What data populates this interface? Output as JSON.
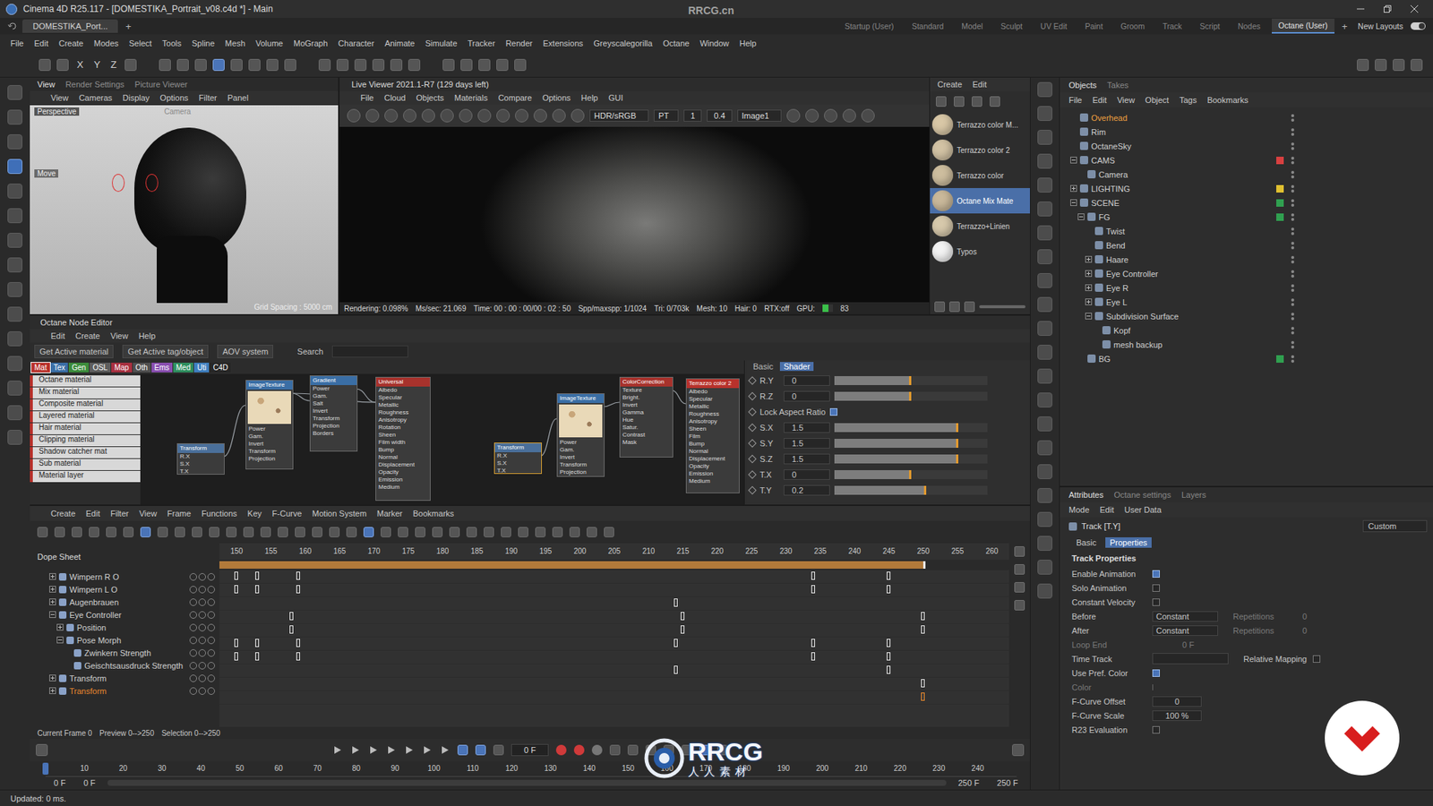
{
  "window": {
    "title": "Cinema 4D R25.117 - [DOMESTIKA_Portrait_v08.c4d *] - Main"
  },
  "watermark": {
    "site": "RRCG.cn",
    "logo": "RRCG",
    "subtitle": "人人素材"
  },
  "doc_tabs": [
    {
      "label": "DOMESTIKA_Port...",
      "selected": true
    }
  ],
  "doc_add": "+",
  "layouts": [
    {
      "label": "Startup (User)",
      "selected": false
    },
    {
      "label": "Standard",
      "selected": false
    },
    {
      "label": "Model",
      "selected": false
    },
    {
      "label": "Sculpt",
      "selected": false
    },
    {
      "label": "UV Edit",
      "selected": false
    },
    {
      "label": "Paint",
      "selected": false
    },
    {
      "label": "Groom",
      "selected": false
    },
    {
      "label": "Track",
      "selected": false
    },
    {
      "label": "Script",
      "selected": false
    },
    {
      "label": "Nodes",
      "selected": false
    },
    {
      "label": "Octane (User)",
      "selected": true
    }
  ],
  "layout_add": "+",
  "new_layouts": "New Layouts",
  "menu": [
    "File",
    "Edit",
    "Create",
    "Modes",
    "Select",
    "Tools",
    "Spline",
    "Mesh",
    "Volume",
    "MoGraph",
    "Character",
    "Animate",
    "Simulate",
    "Tracker",
    "Render",
    "Extensions",
    "Greyscalegorilla",
    "Octane",
    "Window",
    "Help"
  ],
  "toolbar": {
    "axes": [
      "X",
      "Y",
      "Z"
    ]
  },
  "viewport": {
    "tabs": [
      {
        "label": "View",
        "selected": true
      },
      {
        "label": "Render Settings",
        "selected": false
      },
      {
        "label": "Picture Viewer",
        "selected": false
      }
    ],
    "menu": [
      "View",
      "Cameras",
      "Display",
      "Options",
      "Filter",
      "Panel"
    ],
    "camera_label": "Perspective",
    "camera_name": "Camera",
    "tool": "Move",
    "grid": "Grid Spacing : 5000 cm"
  },
  "live_viewer": {
    "title": "Live Viewer 2021.1-R7 (129 days left)",
    "menu": [
      "File",
      "Cloud",
      "Objects",
      "Materials",
      "Compare",
      "Options",
      "Help",
      "GUI"
    ],
    "color_space": "HDR/sRGB",
    "kernel": "PT",
    "frame": "1",
    "exposure": "0.4",
    "image": "Image1",
    "status": [
      "Rendering: 0.098%",
      "Ms/sec: 21.069",
      "Time: 00 : 00 : 00/00 : 02 : 50",
      "Spp/maxspp: 1/1024",
      "Tri: 0/703k",
      "Mesh: 10",
      "Hair: 0",
      "RTX:off"
    ],
    "gpu_label": "GPU:",
    "gpu_level": 0.6,
    "gpu_value": "83"
  },
  "materials": {
    "menu": [
      "Create",
      "Edit"
    ],
    "items": [
      {
        "name": "Terrazzo color M...",
        "selected": false,
        "color": "#d8c7a6"
      },
      {
        "name": "Terrazzo color 2",
        "selected": false,
        "color": "#d2c2a4"
      },
      {
        "name": "Terrazzo color",
        "selected": false,
        "color": "#cdbd9e"
      },
      {
        "name": "Octane Mix Mate",
        "selected": true,
        "color": "#c9b89a"
      },
      {
        "name": "Terrazzo+Linien",
        "selected": false,
        "color": "#d6c8ab"
      },
      {
        "name": "Typos",
        "selected": false,
        "color": "#f2f2f2"
      }
    ]
  },
  "node_editor": {
    "title": "Octane Node Editor",
    "menu": [
      "Edit",
      "Create",
      "View",
      "Help"
    ],
    "buttons": [
      "Get Active material",
      "Get Active tag/object",
      "AOV system"
    ],
    "search_label": "Search",
    "categories": [
      {
        "label": "Mat",
        "color": "#b8322c",
        "selected": true
      },
      {
        "label": "Tex",
        "color": "#3a6ea5",
        "selected": false
      },
      {
        "label": "Gen",
        "color": "#3c8c3c",
        "selected": false
      },
      {
        "label": "OSL",
        "color": "#5e5e5e",
        "selected": false
      },
      {
        "label": "Map",
        "color": "#a83040",
        "selected": false
      },
      {
        "label": "Oth",
        "color": "#505050",
        "selected": false
      },
      {
        "label": "Ems",
        "color": "#8a4fb0",
        "selected": false
      },
      {
        "label": "Med",
        "color": "#2f8f5f",
        "selected": false
      },
      {
        "label": "Uti",
        "color": "#3f7fbf",
        "selected": false
      },
      {
        "label": "C4D",
        "color": "#262626",
        "selected": false
      }
    ],
    "node_types": [
      "Octane material",
      "Mix material",
      "Composite material",
      "Layered material",
      "Hair material",
      "Clipping material",
      "Shadow catcher mat",
      "Sub material",
      "Material layer"
    ],
    "nodes": [
      {
        "title": "Transform",
        "color": "#4a6f9a",
        "thumbnail": false,
        "ports": [
          "R.X",
          "S.X",
          "T.X"
        ]
      },
      {
        "title": "ImageTexture",
        "color": "#3a6ea5",
        "thumbnail": true,
        "ports": [
          "Power",
          "Gam.",
          "Invert",
          "Transform",
          "Projection"
        ]
      },
      {
        "title": "Gradient",
        "color": "#3a6ea5",
        "thumbnail": false,
        "ports": [
          "Power",
          "Gam.",
          "Salt",
          "Invert",
          "Transform",
          "Projection",
          "Borders"
        ]
      },
      {
        "title": "Universal",
        "color": "#a8322c",
        "thumbnail": false,
        "ports": [
          "Albedo",
          "Specular",
          "Metallic",
          "Roughness",
          "Anisotropy",
          "Rotation",
          "Sheen",
          "Film width",
          "Bump",
          "Normal",
          "Displacement",
          "Opacity",
          "Emission",
          "Medium"
        ]
      },
      {
        "title": "Transform",
        "color": "#4a6f9a",
        "thumbnail": false,
        "ports": [
          "R.X",
          "S.X",
          "T.X"
        ]
      },
      {
        "title": "ImageTexture",
        "color": "#3a6ea5",
        "thumbnail": true,
        "ports": [
          "Power",
          "Gam.",
          "Invert",
          "Transform",
          "Projection"
        ]
      },
      {
        "title": "ColorCorrection",
        "color": "#a8322c",
        "thumbnail": false,
        "ports": [
          "Texture",
          "Bright.",
          "Invert",
          "Gamma",
          "Hue",
          "Satur.",
          "Contrast",
          "Mask"
        ]
      },
      {
        "title": "Terrazzo color 2",
        "color": "#b8322c",
        "thumbnail": false,
        "ports": [
          "Albedo",
          "Specular",
          "Metallic",
          "Roughness",
          "Anisotropy",
          "Sheen",
          "Film",
          "Bump",
          "Normal",
          "Displacement",
          "Opacity",
          "Emission",
          "Medium"
        ]
      }
    ],
    "links": [
      [
        0,
        1
      ],
      [
        1,
        2
      ],
      [
        2,
        3
      ],
      [
        1,
        3
      ],
      [
        4,
        5
      ],
      [
        5,
        6
      ],
      [
        6,
        7
      ]
    ],
    "prop_tabs": [
      {
        "label": "Basic",
        "selected": false
      },
      {
        "label": "Shader",
        "selected": true
      }
    ],
    "props": [
      {
        "kind": "slider",
        "label": "R.Y",
        "value": "0",
        "level": 0.5
      },
      {
        "kind": "slider",
        "label": "R.Z",
        "value": "0",
        "level": 0.5
      },
      {
        "kind": "check",
        "label": "Lock Aspect Ratio",
        "checked": true
      },
      {
        "kind": "slider",
        "label": "S.X",
        "value": "1.5",
        "level": 0.81
      },
      {
        "kind": "slider",
        "label": "S.Y",
        "value": "1.5",
        "level": 0.81
      },
      {
        "kind": "slider",
        "label": "S.Z",
        "value": "1.5",
        "level": 0.81
      },
      {
        "kind": "slider",
        "label": "T.X",
        "value": "0",
        "level": 0.5
      },
      {
        "kind": "slider",
        "label": "T.Y",
        "value": "0.2",
        "level": 0.6
      }
    ]
  },
  "timeline": {
    "menu": [
      "Create",
      "Edit",
      "Filter",
      "View",
      "Frame",
      "Functions",
      "Key",
      "F-Curve",
      "Motion System",
      "Marker",
      "Bookmarks"
    ],
    "title": "Dope Sheet",
    "ruler": [
      "150",
      "155",
      "160",
      "165",
      "170",
      "175",
      "180",
      "185",
      "190",
      "195",
      "200",
      "205",
      "210",
      "215",
      "220",
      "225",
      "230",
      "235",
      "240",
      "245",
      "250",
      "255",
      "260"
    ],
    "tracks": [
      {
        "name": "Wimpern R O",
        "depth": 0,
        "children": true,
        "expanded": false,
        "selected": false,
        "keys": [
          150,
          153,
          159,
          234,
          245
        ]
      },
      {
        "name": "Wimpern L O",
        "depth": 0,
        "children": true,
        "expanded": false,
        "selected": false,
        "keys": [
          150,
          153,
          159,
          234,
          245
        ]
      },
      {
        "name": "Augenbrauen",
        "depth": 0,
        "children": true,
        "expanded": false,
        "selected": false,
        "keys": [
          214
        ]
      },
      {
        "name": "Eye Controller",
        "depth": 0,
        "children": true,
        "expanded": true,
        "selected": false,
        "keys": [
          158,
          215,
          250
        ]
      },
      {
        "name": "Position",
        "depth": 1,
        "children": true,
        "expanded": false,
        "selected": false,
        "keys": [
          158,
          215,
          250
        ]
      },
      {
        "name": "Pose Morph",
        "depth": 1,
        "children": true,
        "expanded": true,
        "selected": false,
        "keys": [
          150,
          153,
          159,
          214,
          234,
          245
        ]
      },
      {
        "name": "Zwinkern Strength",
        "depth": 2,
        "children": false,
        "expanded": false,
        "selected": false,
        "keys": [
          150,
          153,
          159,
          234,
          245
        ]
      },
      {
        "name": "Geischtsausdruck Strength",
        "depth": 2,
        "children": false,
        "expanded": false,
        "selected": false,
        "keys": [
          214,
          245
        ]
      },
      {
        "name": "Transform",
        "depth": 0,
        "children": true,
        "expanded": false,
        "selected": false,
        "keys": [
          250
        ]
      },
      {
        "name": "Transform",
        "depth": 0,
        "children": true,
        "expanded": false,
        "selected": true,
        "keys": [
          250
        ]
      }
    ],
    "status": [
      "Current Frame 0",
      "Preview 0-->250",
      "Selection 0-->250"
    ]
  },
  "transport": {
    "frame": "0 F",
    "ruler": [
      "10",
      "20",
      "30",
      "40",
      "50",
      "60",
      "70",
      "80",
      "90",
      "100",
      "110",
      "120",
      "130",
      "140",
      "150",
      "160",
      "170",
      "180",
      "190",
      "200",
      "210",
      "220",
      "230",
      "240"
    ],
    "start": "0 F",
    "start2": "0 F",
    "end": "250 F",
    "end2": "250 F"
  },
  "objects": {
    "tabs": [
      {
        "label": "Objects",
        "selected": true
      },
      {
        "label": "Takes",
        "selected": false
      }
    ],
    "menu": [
      "File",
      "Edit",
      "View",
      "Object",
      "Tags",
      "Bookmarks"
    ],
    "items": [
      {
        "name": "Overhead",
        "depth": 0,
        "children": false,
        "expanded": false,
        "selected": true,
        "color": ""
      },
      {
        "name": "Rim",
        "depth": 0,
        "children": false,
        "expanded": false,
        "selected": false,
        "color": ""
      },
      {
        "name": "OctaneSky",
        "depth": 0,
        "children": false,
        "expanded": false,
        "selected": false,
        "color": ""
      },
      {
        "name": "CAMS",
        "depth": 0,
        "children": true,
        "expanded": true,
        "selected": false,
        "color": "#d84040"
      },
      {
        "name": "Camera",
        "depth": 1,
        "children": false,
        "expanded": false,
        "selected": false,
        "color": ""
      },
      {
        "name": "LIGHTING",
        "depth": 0,
        "children": true,
        "expanded": false,
        "selected": false,
        "color": "#e0c030"
      },
      {
        "name": "SCENE",
        "depth": 0,
        "children": true,
        "expanded": true,
        "selected": false,
        "color": "#30a050"
      },
      {
        "name": "FG",
        "depth": 1,
        "children": true,
        "expanded": true,
        "selected": false,
        "color": "#30a050"
      },
      {
        "name": "Twist",
        "depth": 2,
        "children": false,
        "expanded": false,
        "selected": false,
        "color": ""
      },
      {
        "name": "Bend",
        "depth": 2,
        "children": false,
        "expanded": false,
        "selected": false,
        "color": ""
      },
      {
        "name": "Haare",
        "depth": 2,
        "children": true,
        "expanded": false,
        "selected": false,
        "color": ""
      },
      {
        "name": "Eye Controller",
        "depth": 2,
        "children": true,
        "expanded": false,
        "selected": false,
        "color": ""
      },
      {
        "name": "Eye R",
        "depth": 2,
        "children": true,
        "expanded": false,
        "selected": false,
        "color": ""
      },
      {
        "name": "Eye L",
        "depth": 2,
        "children": true,
        "expanded": false,
        "selected": false,
        "color": ""
      },
      {
        "name": "Subdivision Surface",
        "depth": 2,
        "children": true,
        "expanded": true,
        "selected": false,
        "color": ""
      },
      {
        "name": "Kopf",
        "depth": 3,
        "children": false,
        "expanded": false,
        "selected": false,
        "color": ""
      },
      {
        "name": "mesh backup",
        "depth": 3,
        "children": false,
        "expanded": false,
        "selected": false,
        "color": ""
      },
      {
        "name": "BG",
        "depth": 1,
        "children": false,
        "expanded": false,
        "selected": false,
        "color": "#30a050"
      }
    ]
  },
  "attributes": {
    "tabs": [
      {
        "label": "Attributes",
        "selected": true
      },
      {
        "label": "Octane settings",
        "selected": false
      },
      {
        "label": "Layers",
        "selected": false
      }
    ],
    "menu": [
      "Mode",
      "Edit",
      "User Data"
    ],
    "track": "Track [T.Y]",
    "preset": "Custom",
    "subtabs": [
      {
        "label": "Basic",
        "selected": false
      },
      {
        "label": "Properties",
        "selected": true
      }
    ],
    "section": "Track Properties",
    "rows": [
      {
        "kind": "check",
        "label": "Enable Animation",
        "checked": true
      },
      {
        "kind": "check",
        "label": "Solo Animation",
        "checked": false
      },
      {
        "kind": "check",
        "label": "Constant Velocity",
        "checked": false
      },
      {
        "kind": "select",
        "label": "Before",
        "value": "Constant",
        "extra_label": "Repetitions",
        "extra_value": "0"
      },
      {
        "kind": "select",
        "label": "After",
        "value": "Constant",
        "extra_label": "Repetitions",
        "extra_value": "0"
      },
      {
        "kind": "field",
        "label": "Loop End",
        "value": "0 F",
        "disabled": true
      },
      {
        "kind": "link",
        "label": "Time Track",
        "extra_label": "Relative Mapping",
        "checked": false
      },
      {
        "kind": "check",
        "label": "Use Pref. Color",
        "checked": true
      },
      {
        "kind": "color",
        "label": "Color",
        "disabled": true
      },
      {
        "kind": "number",
        "label": "F-Curve Offset",
        "value": "0"
      },
      {
        "kind": "number",
        "label": "F-Curve Scale",
        "value": "100 %"
      },
      {
        "kind": "check",
        "label": "R23 Evaluation",
        "checked": false
      }
    ]
  },
  "status_bar": "Updated: 0 ms."
}
